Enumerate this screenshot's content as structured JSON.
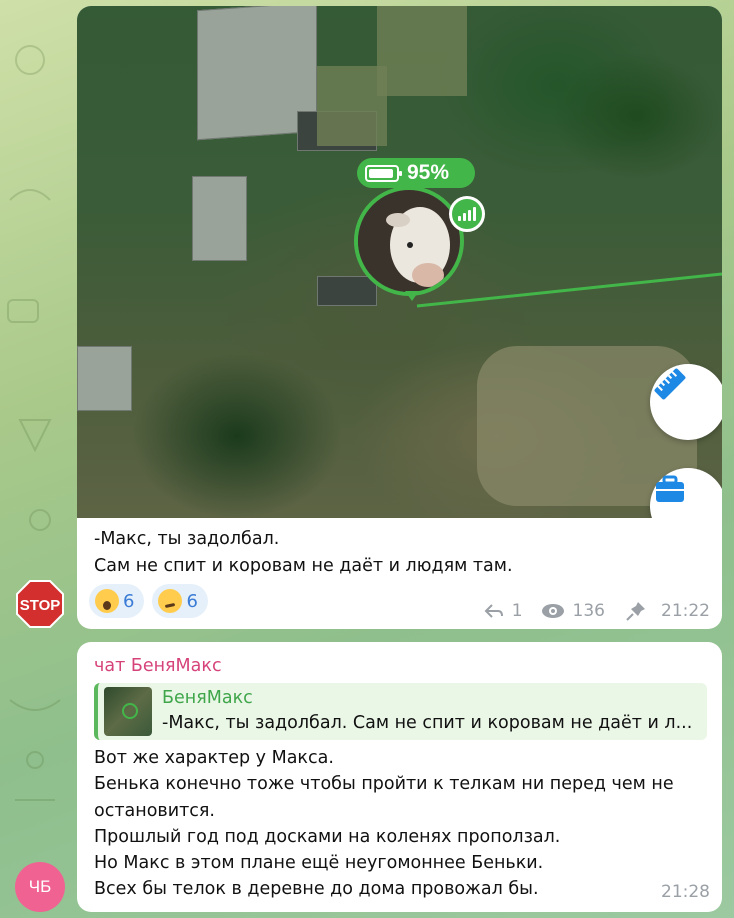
{
  "message1": {
    "map": {
      "battery_percent": "95%",
      "ruler_button": "ruler-icon",
      "toolbox_button": "toolbox-icon"
    },
    "text_lines": [
      "-Макс, ты задолбал.",
      "Сам не спит и коровам не даёт и людям там."
    ],
    "reactions": [
      {
        "emoji": "face-screaming",
        "count": "6"
      },
      {
        "emoji": "woozy-face",
        "count": "6"
      }
    ],
    "replies_count": "1",
    "views": "136",
    "time": "21:22",
    "author_avatar": {
      "label": "STOP",
      "color": "#d32f2f"
    }
  },
  "message2": {
    "sender": "чат БеняМакс",
    "reply": {
      "name": "БеняМакс",
      "text": "-Макс, ты задолбал.  Сам не спит и коровам не даёт и л..."
    },
    "lines": [
      "Вот же характер у Макса.",
      "Бенька конечно тоже чтобы пройти к телкам ни перед чем не",
      "остановится.",
      "Прошлый год под досками на коленях проползал.",
      "Но Макс в этом плане ещё неугомоннее Беньки.",
      "Всех бы телок в деревне до дома провожал бы."
    ],
    "time": "21:28",
    "author_avatar": {
      "initials": "ЧБ",
      "color": "#f06292"
    }
  },
  "colors": {
    "accent_green": "#43b649",
    "sender_pink": "#d6437a",
    "reaction_blue": "#3a7bd5"
  }
}
